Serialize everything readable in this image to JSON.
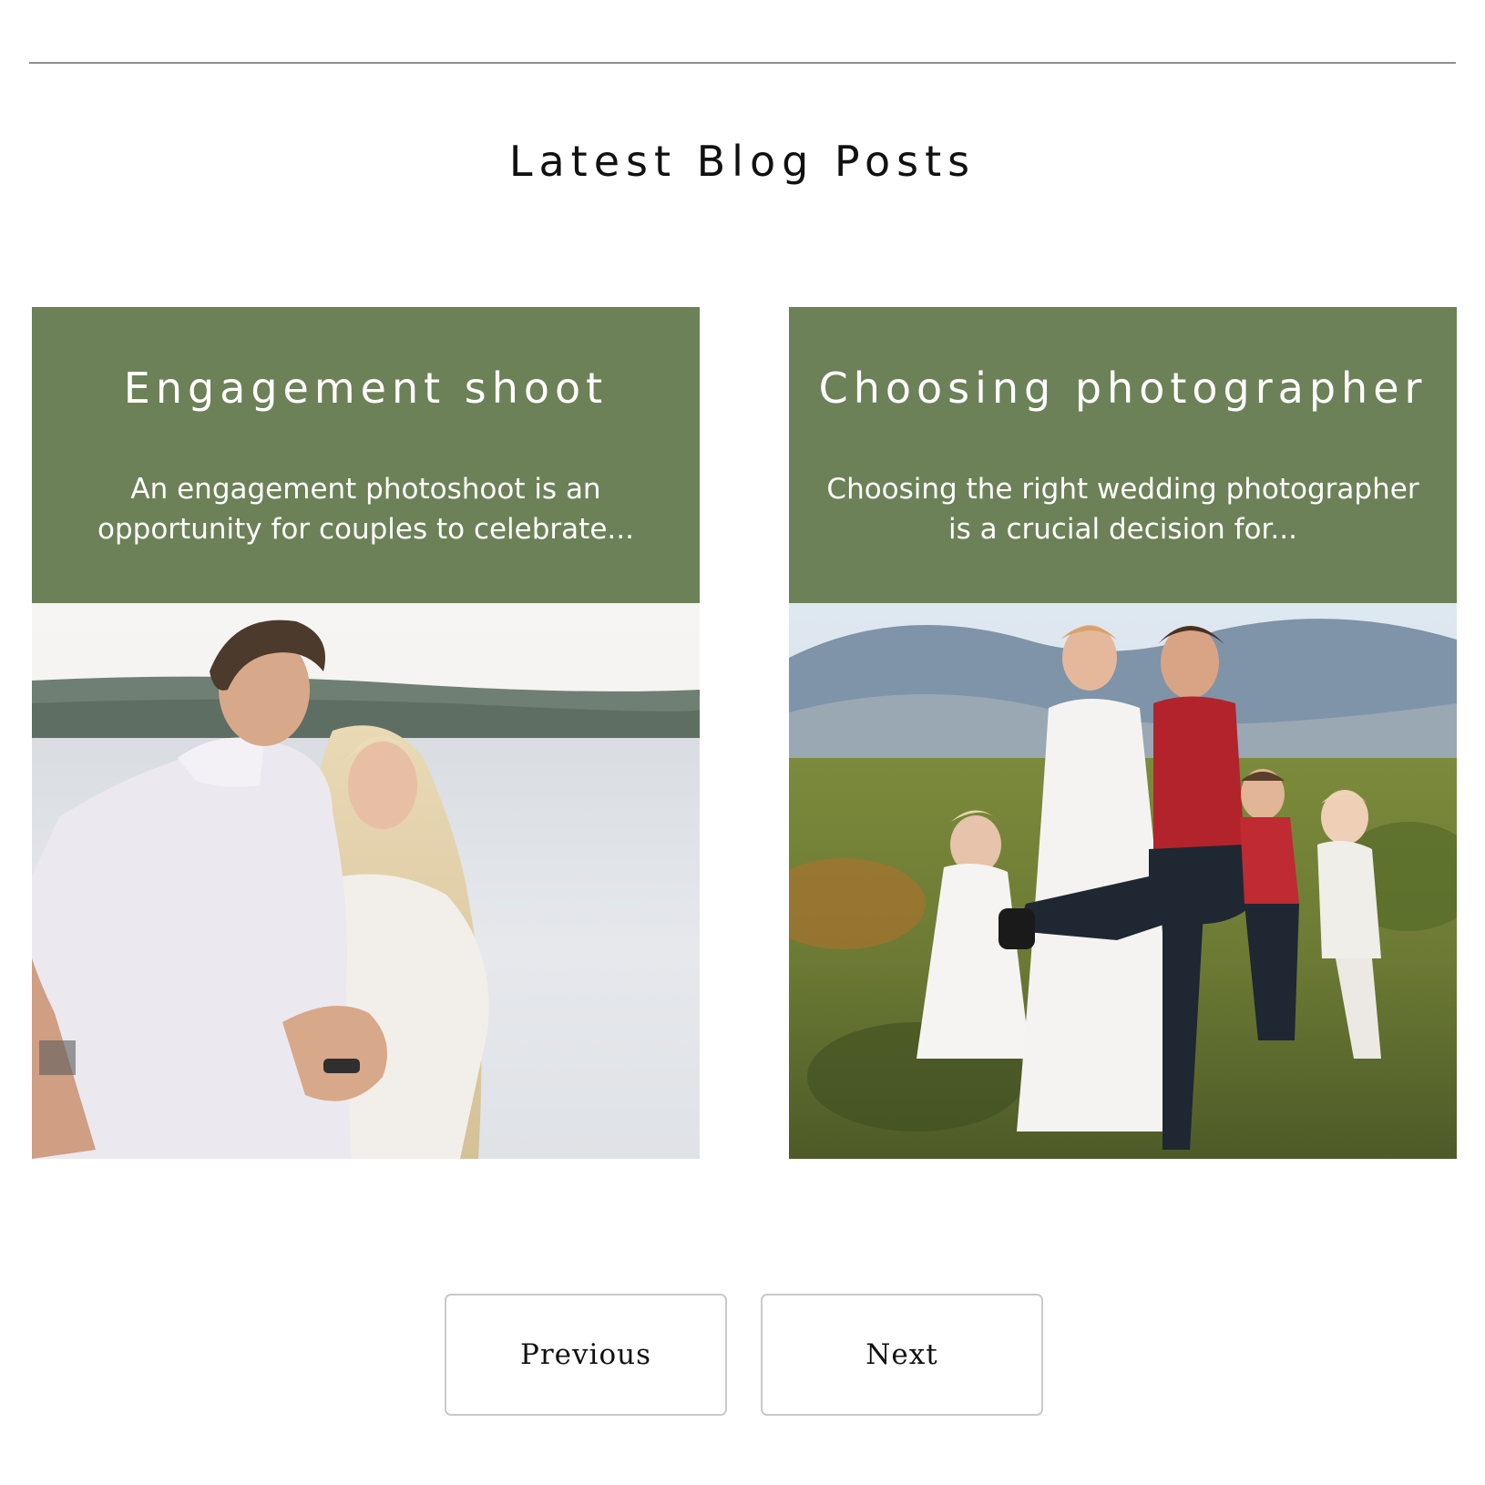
{
  "section": {
    "title": "Latest Blog Posts"
  },
  "posts": [
    {
      "title": "Engagement shoot",
      "excerpt": "An engagement photoshoot is an opportunity for couples to celebrate..."
    },
    {
      "title": "Choosing photographer",
      "excerpt": "Choosing the right wedding photographer is a crucial decision for..."
    }
  ],
  "pagination": {
    "previous_label": "Previous",
    "next_label": "Next"
  },
  "colors": {
    "card_header": "#6c8157",
    "card_text": "#ffffff",
    "rule": "#8f8f8f",
    "button_border": "#c9c9c9"
  }
}
